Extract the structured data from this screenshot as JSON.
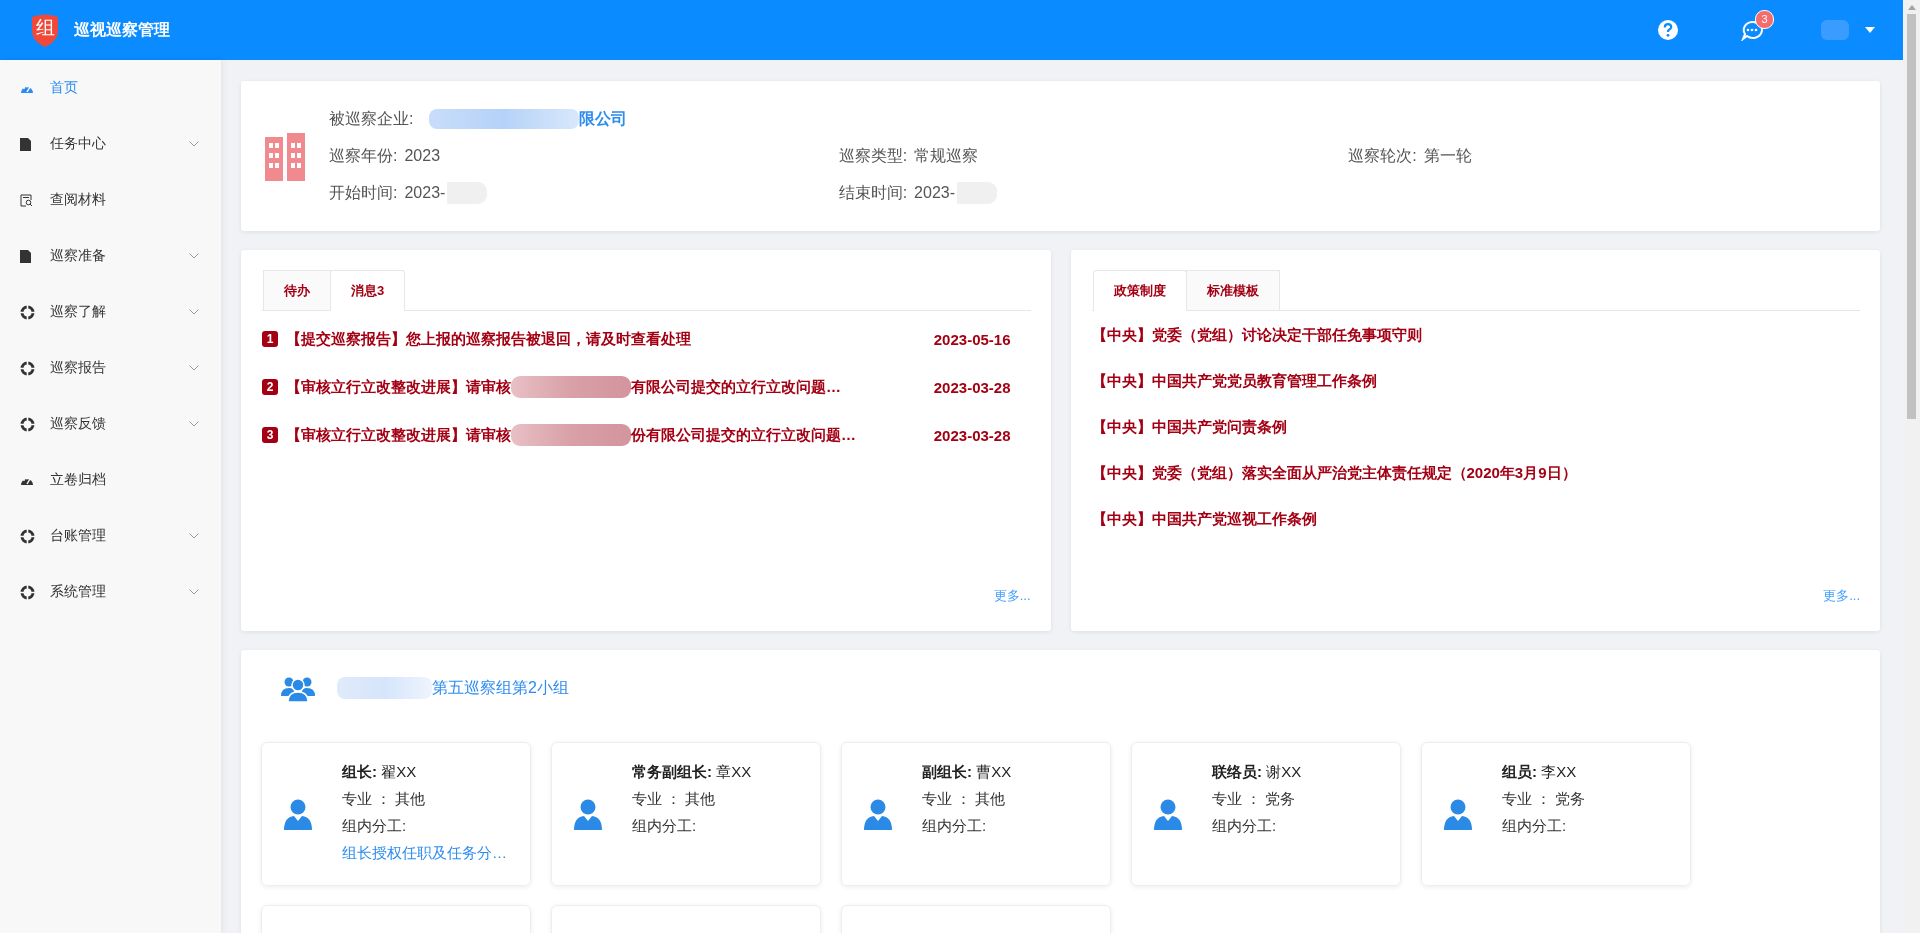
{
  "header": {
    "logo_text": "组",
    "title": "巡视巡察管理",
    "notification_count": "3"
  },
  "sidebar": {
    "items": [
      {
        "label": "首页",
        "kind": "gauge",
        "expandable": false,
        "selected": true
      },
      {
        "label": "任务中心",
        "kind": "file",
        "expandable": true,
        "selected": false
      },
      {
        "label": "查阅材料",
        "kind": "search",
        "expandable": false,
        "selected": false
      },
      {
        "label": "巡察准备",
        "kind": "file",
        "expandable": true,
        "selected": false
      },
      {
        "label": "巡察了解",
        "kind": "ring",
        "expandable": true,
        "selected": false
      },
      {
        "label": "巡察报告",
        "kind": "ring",
        "expandable": true,
        "selected": false
      },
      {
        "label": "巡察反馈",
        "kind": "ring",
        "expandable": true,
        "selected": false
      },
      {
        "label": "立卷归档",
        "kind": "gauge",
        "expandable": false,
        "selected": false
      },
      {
        "label": "台账管理",
        "kind": "ring",
        "expandable": true,
        "selected": false
      },
      {
        "label": "系统管理",
        "kind": "ring",
        "expandable": true,
        "selected": false
      }
    ]
  },
  "inspection": {
    "enterprise_label": "被巡察企业:",
    "enterprise_name": "限公司",
    "fields": [
      {
        "label": "巡察年份:",
        "value": "2023",
        "redacted": false
      },
      {
        "label": "巡察类型:",
        "value": "常规巡察",
        "redacted": false
      },
      {
        "label": "巡察轮次:",
        "value": "第一轮",
        "redacted": false
      },
      {
        "label": "开始时间:",
        "value": "2023-",
        "redacted": true
      },
      {
        "label": "结束时间:",
        "value": "2023-",
        "redacted": true
      }
    ]
  },
  "panels": [
    {
      "tabs": [
        {
          "label": "待办",
          "selected": false
        },
        {
          "label": "消息3",
          "selected": true
        }
      ],
      "items": [
        {
          "number": "1",
          "text": "【提交巡察报告】您上报的巡察报告被退回，请及时查看处理",
          "redacted": false,
          "date": "2023-05-16"
        },
        {
          "number": "2",
          "text": "【审核立行立改整改进展】请审核",
          "text_after": "有限公司提交的立行立改问题…",
          "redacted": true,
          "date": "2023-03-28"
        },
        {
          "number": "3",
          "text": "【审核立行立改整改进展】请审核",
          "text_after": "份有限公司提交的立行立改问题…",
          "redacted": true,
          "date": "2023-03-28"
        }
      ],
      "more": "更多..."
    },
    {
      "tabs": [
        {
          "label": "政策制度",
          "selected": true
        },
        {
          "label": "标准模板",
          "selected": false
        }
      ],
      "items": [
        {
          "text": "【中央】党委（党组）讨论决定干部任免事项守则"
        },
        {
          "text": "【中央】中国共产党党员教育管理工作条例"
        },
        {
          "text": "【中央】中国共产党问责条例"
        },
        {
          "text": "【中央】党委（党组）落实全面从严治党主体责任规定（2020年3月9日）"
        },
        {
          "text": "【中央】中国共产党巡视工作条例"
        }
      ],
      "more": "更多..."
    }
  ],
  "group": {
    "title": "第五巡察组第2小组",
    "members": [
      {
        "kind": "full",
        "role_line": "**组长:** 翟XX",
        "major": "专业 ： 其他",
        "duty_label": "组内分工:",
        "duty": "组长授权任职及任务分…"
      },
      {
        "kind": "full",
        "role_line": "**常务副组长:** 章XX",
        "major": "专业 ： 其他",
        "duty_label": "组内分工:"
      },
      {
        "kind": "full",
        "role_line": "**副组长:** 曹XX",
        "major": "专业 ： 其他",
        "duty_label": "组内分工:"
      },
      {
        "kind": "full",
        "role_line": "**联络员:** 谢XX",
        "major": "专业 ： 党务",
        "duty_label": "组内分工:"
      },
      {
        "kind": "full",
        "role_line": "**组员:** 李XX",
        "major": "专业 ： 党务",
        "duty_label": "组内分工:"
      },
      {
        "kind": "cut"
      },
      {
        "kind": "cut"
      },
      {
        "kind": "cut"
      }
    ]
  }
}
